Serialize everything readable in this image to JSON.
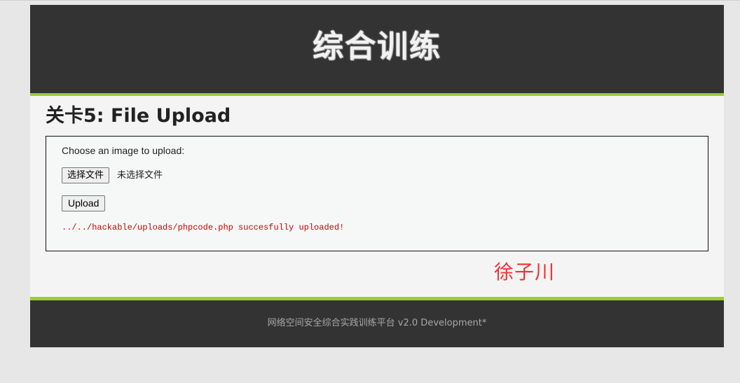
{
  "header": {
    "site_title": "综合训练"
  },
  "page": {
    "heading": "关卡5: File Upload"
  },
  "upload_form": {
    "prompt": "Choose an image to upload:",
    "choose_file_button": "选择文件",
    "file_status": "未选择文件",
    "upload_button": "Upload",
    "result_message": "../../hackable/uploads/phpcode.php succesfully uploaded!"
  },
  "signature": "徐子川",
  "footer": {
    "text": "网络空间安全综合实践训练平台 v2.0 Development*"
  },
  "colors": {
    "header_bg": "#333333",
    "accent_green": "#9acd32",
    "result_red": "#cc0000",
    "signature_red": "#ee3333"
  }
}
